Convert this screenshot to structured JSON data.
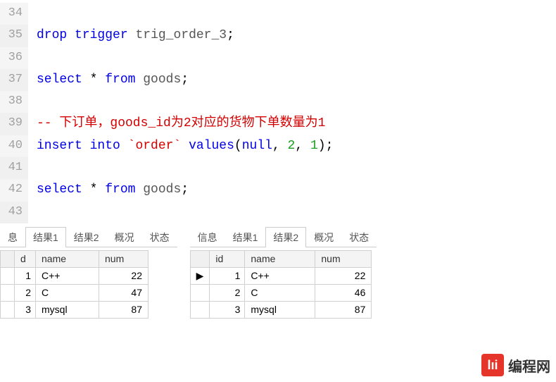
{
  "editor": {
    "lines": [
      {
        "n": "34",
        "spans": []
      },
      {
        "n": "35",
        "spans": [
          {
            "cls": "kw",
            "t": "drop"
          },
          {
            "cls": "",
            "t": " "
          },
          {
            "cls": "kw",
            "t": "trigger"
          },
          {
            "cls": "",
            "t": " "
          },
          {
            "cls": "ident",
            "t": "trig_order_3"
          },
          {
            "cls": "",
            "t": ";"
          }
        ]
      },
      {
        "n": "36",
        "spans": []
      },
      {
        "n": "37",
        "spans": [
          {
            "cls": "kw",
            "t": "select"
          },
          {
            "cls": "",
            "t": " * "
          },
          {
            "cls": "kw",
            "t": "from"
          },
          {
            "cls": "",
            "t": " "
          },
          {
            "cls": "ident",
            "t": "goods"
          },
          {
            "cls": "",
            "t": ";"
          }
        ]
      },
      {
        "n": "38",
        "spans": []
      },
      {
        "n": "39",
        "spans": [
          {
            "cls": "comment",
            "t": "-- 下订单，goods_id为2对应的货物下单数量为1"
          }
        ]
      },
      {
        "n": "40",
        "spans": [
          {
            "cls": "kw",
            "t": "insert"
          },
          {
            "cls": "",
            "t": " "
          },
          {
            "cls": "kw",
            "t": "into"
          },
          {
            "cls": "",
            "t": " "
          },
          {
            "cls": "str",
            "t": "`order`"
          },
          {
            "cls": "",
            "t": " "
          },
          {
            "cls": "kw",
            "t": "values"
          },
          {
            "cls": "",
            "t": "("
          },
          {
            "cls": "kw",
            "t": "null"
          },
          {
            "cls": "",
            "t": ", "
          },
          {
            "cls": "num",
            "t": "2"
          },
          {
            "cls": "",
            "t": ", "
          },
          {
            "cls": "num",
            "t": "1"
          },
          {
            "cls": "",
            "t": ");"
          }
        ]
      },
      {
        "n": "41",
        "spans": []
      },
      {
        "n": "42",
        "spans": [
          {
            "cls": "kw",
            "t": "select"
          },
          {
            "cls": "",
            "t": " * "
          },
          {
            "cls": "kw",
            "t": "from"
          },
          {
            "cls": "",
            "t": " "
          },
          {
            "cls": "ident",
            "t": "goods"
          },
          {
            "cls": "",
            "t": ";"
          }
        ]
      },
      {
        "n": "43",
        "spans": []
      }
    ]
  },
  "panels": {
    "left": {
      "tabs": [
        "息",
        "结果1",
        "结果2",
        "概况",
        "状态"
      ],
      "active": 1,
      "columns": [
        "",
        "d",
        "name",
        "num"
      ],
      "rows": [
        {
          "mark": "",
          "id": "1",
          "name": "C++",
          "num": "22"
        },
        {
          "mark": "",
          "id": "2",
          "name": "C",
          "num": "47"
        },
        {
          "mark": "",
          "id": "3",
          "name": "mysql",
          "num": "87"
        }
      ]
    },
    "right": {
      "tabs": [
        "信息",
        "结果1",
        "结果2",
        "概况",
        "状态"
      ],
      "active": 2,
      "columns": [
        "",
        "id",
        "name",
        "num"
      ],
      "rows": [
        {
          "mark": "▶",
          "id": "1",
          "name": "C++",
          "num": "22"
        },
        {
          "mark": "",
          "id": "2",
          "name": "C",
          "num": "46"
        },
        {
          "mark": "",
          "id": "3",
          "name": "mysql",
          "num": "87"
        }
      ]
    }
  },
  "watermark": {
    "logo": "lıi",
    "text": "编程网"
  }
}
